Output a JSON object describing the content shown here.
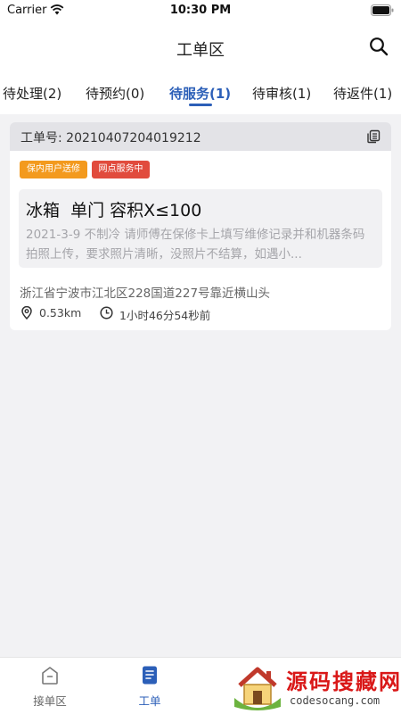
{
  "status_bar": {
    "carrier": "Carrier",
    "time": "10:30 PM"
  },
  "header": {
    "title": "工单区"
  },
  "tabs": [
    {
      "label": "待处理(2)",
      "active": false
    },
    {
      "label": "待预约(0)",
      "active": false
    },
    {
      "label": "待服务(1)",
      "active": true
    },
    {
      "label": "待审核(1)",
      "active": false
    },
    {
      "label": "待返件(1)",
      "active": false
    }
  ],
  "order": {
    "label": "工单号:",
    "number": "20210407204019212",
    "badges": [
      "保内用户送修",
      "网点服务中"
    ],
    "product_title": "冰箱  单门 容积X≤100",
    "description": "2021-3-9 不制冷 请师傅在保修卡上填写维修记录并和机器条码拍照上传，要求照片清晰，没照片不结算，如遇小...",
    "address": "浙江省宁波市江北区228国道227号靠近横山头",
    "distance": "0.53km",
    "elapsed": "1小时46分54秒前"
  },
  "bottom_nav": [
    {
      "label": "接单区",
      "active": false
    },
    {
      "label": "工单",
      "active": true
    }
  ],
  "watermark": {
    "text": "源码搜藏网",
    "url": "codesocang.com"
  },
  "colors": {
    "accent": "#2c5fb8",
    "badge_orange": "#f39a1e",
    "badge_red": "#e14b3d"
  }
}
